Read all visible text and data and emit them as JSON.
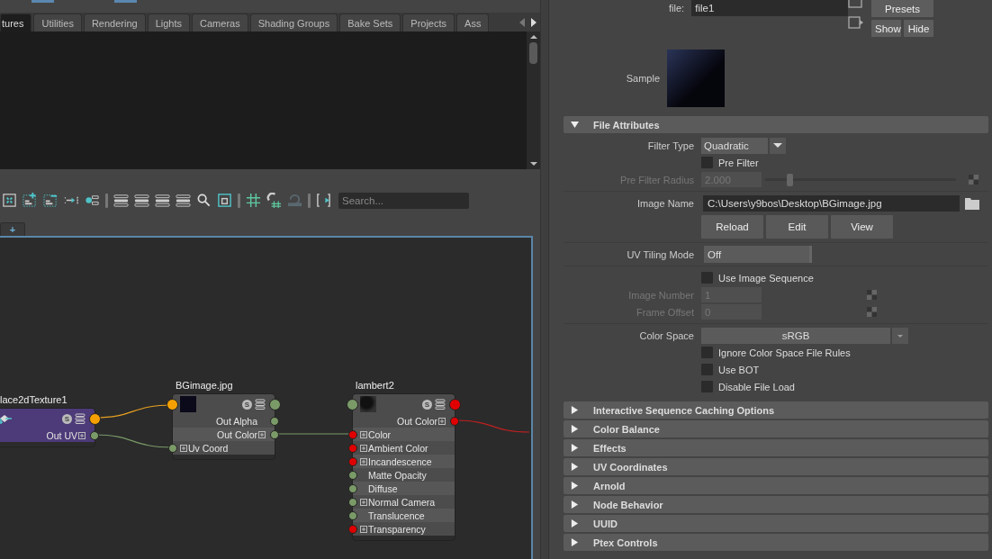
{
  "top_tabs": [
    {
      "label": "tures",
      "selected": true
    },
    {
      "label": "Utilities",
      "selected": false
    },
    {
      "label": "Rendering",
      "selected": false
    },
    {
      "label": "Lights",
      "selected": false
    },
    {
      "label": "Cameras",
      "selected": false
    },
    {
      "label": "Shading Groups",
      "selected": false
    },
    {
      "label": "Bake Sets",
      "selected": false
    },
    {
      "label": "Projects",
      "selected": false
    },
    {
      "label": "Ass",
      "selected": false
    }
  ],
  "toolbar": {
    "search_placeholder": "Search..."
  },
  "graph_tabs": [
    {
      "label": "+",
      "selected": false
    }
  ],
  "nodes": [
    {
      "title": "lace2dTexture1",
      "kind": "place2d",
      "badge": "S",
      "header_ports": [
        {
          "kind": "output",
          "color": "#f5a000"
        }
      ],
      "rows": [
        {
          "label": "Out UV",
          "kind": "output",
          "expandable": true,
          "color": "#7a9a68"
        }
      ]
    },
    {
      "title": "BGimage.jpg",
      "kind": "texture",
      "badge": "S",
      "header_ports": [
        {
          "kind": "input",
          "color": "#f5a000"
        },
        {
          "kind": "output",
          "color": "#7a9a68"
        }
      ],
      "rows": [
        {
          "label": "Out Alpha",
          "kind": "output",
          "expandable": false,
          "color": "#7a9a68"
        },
        {
          "label": "Out Color",
          "kind": "output",
          "expandable": true,
          "color": "#7a9a68"
        },
        {
          "label": "Uv Coord",
          "kind": "input",
          "expandable": true,
          "color": "#7a9a68"
        }
      ]
    },
    {
      "title": "lambert2",
      "kind": "shader",
      "badge": "S",
      "header_ports": [
        {
          "kind": "input",
          "color": "#7a9a68"
        },
        {
          "kind": "output",
          "color": "#e00000"
        }
      ],
      "rows": [
        {
          "label": "Out Color",
          "kind": "output",
          "expandable": true,
          "color": "#e00000"
        },
        {
          "label": "Color",
          "kind": "input",
          "expandable": true,
          "color": "#e00000"
        },
        {
          "label": "Ambient Color",
          "kind": "input",
          "expandable": true,
          "color": "#e00000"
        },
        {
          "label": "Incandescence",
          "kind": "input",
          "expandable": true,
          "color": "#e00000"
        },
        {
          "label": "Matte Opacity",
          "kind": "input",
          "expandable": false,
          "color": "#7a9a68"
        },
        {
          "label": "Diffuse",
          "kind": "input",
          "expandable": false,
          "color": "#7a9a68"
        },
        {
          "label": "Normal Camera",
          "kind": "input",
          "expandable": true,
          "color": "#7a9a68"
        },
        {
          "label": "Translucence",
          "kind": "input",
          "expandable": false,
          "color": "#7a9a68"
        },
        {
          "label": "Transparency",
          "kind": "input",
          "expandable": true,
          "color": "#e00000"
        }
      ]
    }
  ],
  "attribute_editor": {
    "file_label": "file:",
    "file_value": "file1",
    "presets_button": "Presets",
    "show_button": "Show",
    "hide_button": "Hide",
    "sample_label": "Sample",
    "sections": [
      {
        "title": "File Attributes",
        "expanded": true
      },
      {
        "title": "Interactive Sequence Caching Options",
        "expanded": false
      },
      {
        "title": "Color Balance",
        "expanded": false
      },
      {
        "title": "Effects",
        "expanded": false
      },
      {
        "title": "UV Coordinates",
        "expanded": false
      },
      {
        "title": "Arnold",
        "expanded": false
      },
      {
        "title": "Node Behavior",
        "expanded": false
      },
      {
        "title": "UUID",
        "expanded": false
      },
      {
        "title": "Ptex Controls",
        "expanded": false
      }
    ],
    "file_attribute_groups": [
      [
        {
          "kind": "dropdown",
          "label": "Filter Type",
          "value": "Quadratic",
          "disabled": false
        },
        {
          "kind": "checkbox",
          "label": "Pre Filter",
          "checked": false
        },
        {
          "kind": "slider",
          "label": "Pre Filter Radius",
          "value": "2.000",
          "level": 0.13,
          "disabled": true
        }
      ],
      [
        {
          "kind": "path",
          "label": "Image Name",
          "value": "C:\\Users\\y9bos\\Desktop\\BGimage.jpg"
        },
        {
          "kind": "buttons",
          "buttons": [
            "Reload",
            "Edit",
            "View"
          ]
        }
      ],
      [
        {
          "kind": "option",
          "label": "UV Tiling Mode",
          "value": "Off",
          "disabled": false
        }
      ],
      [
        {
          "kind": "checkbox",
          "label": "Use Image Sequence",
          "checked": false
        },
        {
          "kind": "number",
          "label": "Image Number",
          "value": "1",
          "disabled": true
        },
        {
          "kind": "number",
          "label": "Frame Offset",
          "value": "0",
          "disabled": true
        }
      ],
      [
        {
          "kind": "wide_dropdown",
          "label": "Color Space",
          "value": "sRGB",
          "disabled": false
        },
        {
          "kind": "checkbox",
          "label": "Ignore Color Space File Rules",
          "checked": false
        },
        {
          "kind": "checkbox",
          "label": "Use BOT",
          "checked": false
        },
        {
          "kind": "checkbox",
          "label": "Disable File Load",
          "checked": false
        }
      ]
    ]
  }
}
